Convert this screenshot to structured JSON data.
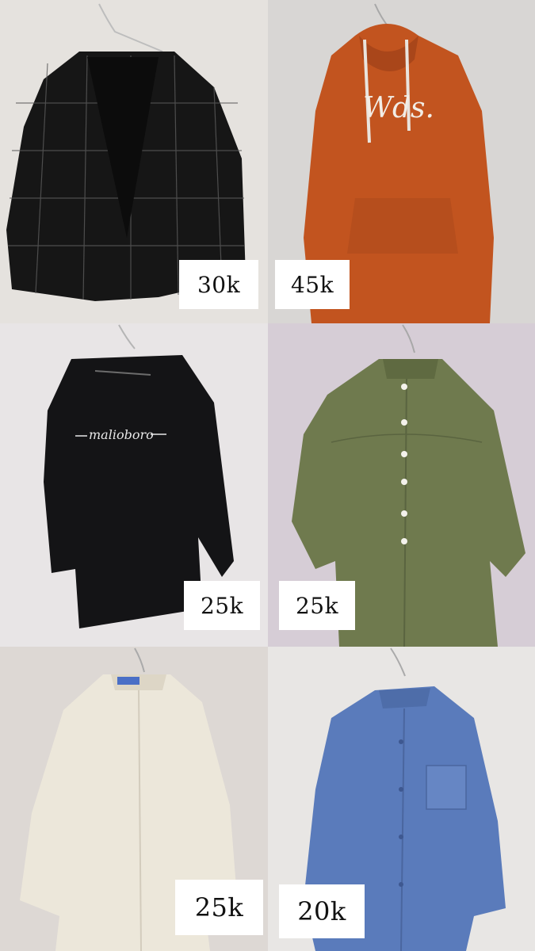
{
  "products": [
    {
      "item": "black-plaid-cardigan",
      "price": "30k",
      "garment_color": "#161616",
      "wall_color": "#e5e2de"
    },
    {
      "item": "orange-hoodie",
      "price": "45k",
      "garment_color": "#c2541f",
      "wall_color": "#d8d6d4",
      "print_text": "Wds."
    },
    {
      "item": "black-malioboro-shirt",
      "price": "25k",
      "garment_color": "#141416",
      "wall_color": "#e8e5e6",
      "print_text": "malioboro"
    },
    {
      "item": "olive-green-shirt",
      "price": "25k",
      "garment_color": "#6f7a4e",
      "wall_color": "#d6cdd6"
    },
    {
      "item": "white-long-shirt",
      "price": "25k",
      "garment_color": "#ece7da",
      "wall_color": "#ddd8d4"
    },
    {
      "item": "blue-denim-shirt",
      "price": "20k",
      "garment_color": "#5a7bbb",
      "wall_color": "#e8e6e4"
    }
  ]
}
